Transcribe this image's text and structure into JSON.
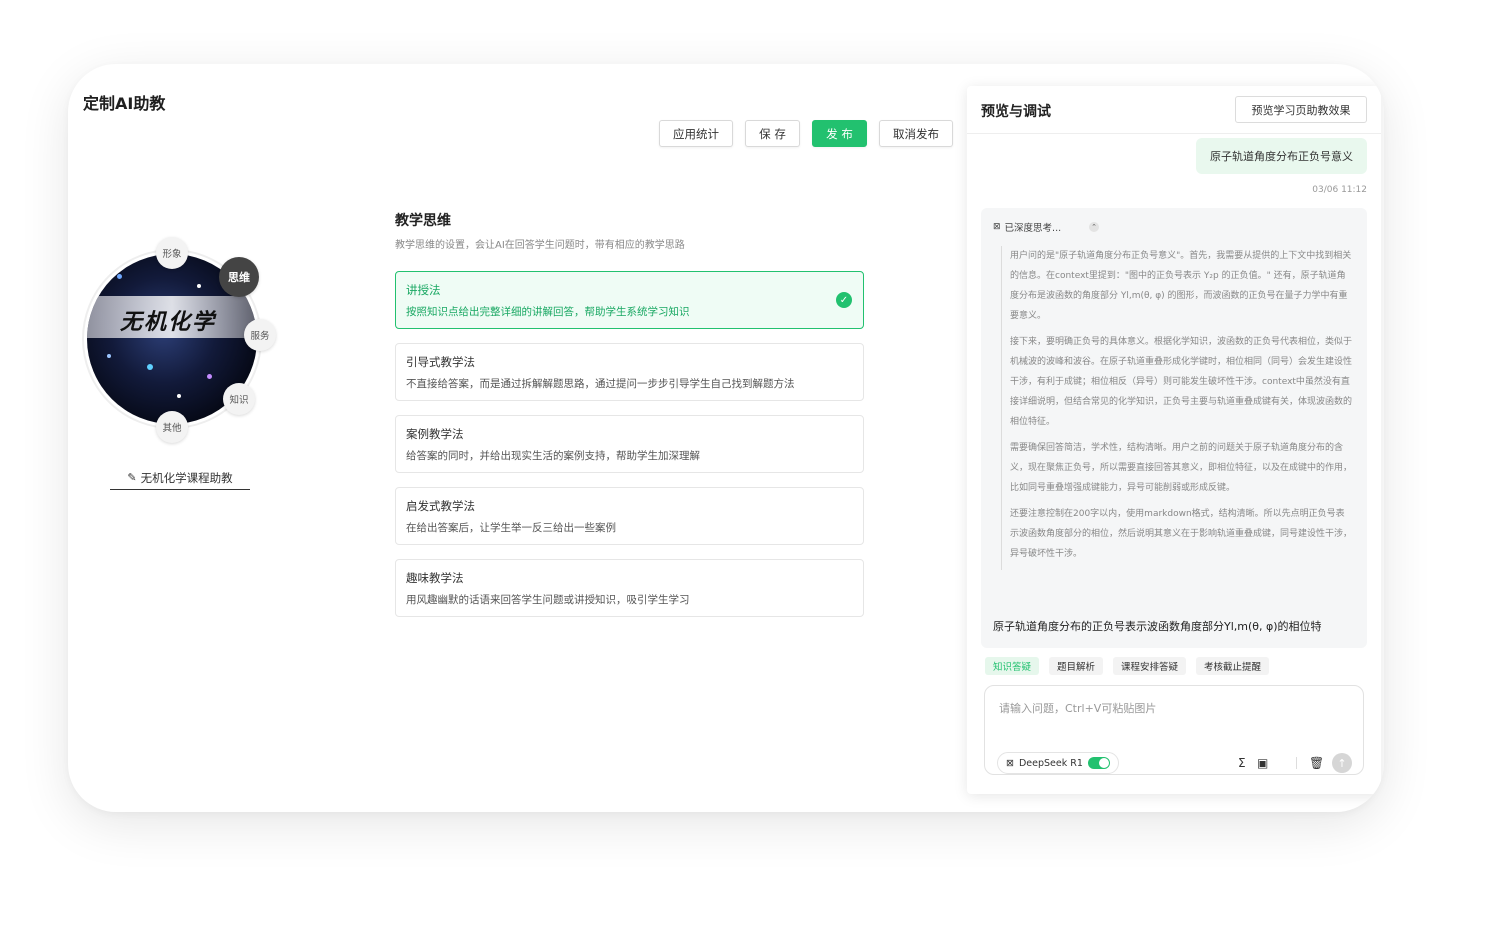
{
  "app": {
    "title": "定制AI助教"
  },
  "toolbar": {
    "stats": "应用统计",
    "save": "保 存",
    "publish": "发 布",
    "unpublish": "取消发布"
  },
  "avatar": {
    "brand_text": "无机化学",
    "chips": {
      "image": "形象",
      "thinking": "思维",
      "service": "服务",
      "knowledge": "知识",
      "other": "其他"
    },
    "name": "无机化学课程助教"
  },
  "teaching": {
    "title": "教学思维",
    "desc": "教学思维的设置，会让AI在回答学生问题时，带有相应的教学思路",
    "methods": [
      {
        "name": "讲授法",
        "desc": "按照知识点给出完整详细的讲解回答，帮助学生系统学习知识"
      },
      {
        "name": "引导式教学法",
        "desc": "不直接给答案，而是通过拆解解题思路，通过提问一步步引导学生自己找到解题方法"
      },
      {
        "name": "案例教学法",
        "desc": "给答案的同时，并给出现实生活的案例支持，帮助学生加深理解"
      },
      {
        "name": "启发式教学法",
        "desc": "在给出答案后，让学生举一反三给出一些案例"
      },
      {
        "name": "趣味教学法",
        "desc": "用风趣幽默的话语来回答学生问题或讲授知识，吸引学生学习"
      }
    ]
  },
  "panel": {
    "title": "预览与调试",
    "preview_btn": "预览学习页助教效果",
    "user_msg": "原子轨道角度分布正负号意义",
    "time": "03/06 11:12",
    "thinking_label": "已深度思考...",
    "thinking": [
      "用户问的是\"原子轨道角度分布正负号意义\"。首先，我需要从提供的上下文中找到相关的信息。在context里提到：\"图中的正负号表示 Y₂p 的正负值。\" 还有，原子轨道角度分布是波函数的角度部分 Yl,m(θ, φ) 的图形，而波函数的正负号在量子力学中有重要意义。",
      "接下来，要明确正负号的具体意义。根据化学知识，波函数的正负号代表相位，类似于机械波的波峰和波谷。在原子轨道重叠形成化学键时，相位相同（同号）会发生建设性干涉，有利于成键；相位相反（异号）则可能发生破坏性干涉。context中虽然没有直接详细说明，但结合常见的化学知识，正负号主要与轨道重叠成键有关，体现波函数的相位特征。",
      "需要确保回答简洁，学术性，结构清晰。用户之前的问题关于原子轨道角度分布的含义，现在聚焦正负号，所以需要直接回答其意义，即相位特征，以及在成键中的作用，比如同号重叠增强成键能力，异号可能削弱或形成反键。",
      "还要注意控制在200字以内，使用markdown格式，结构清晰。所以先点明正负号表示波函数角度部分的相位，然后说明其意义在于影响轨道重叠成键，同号建设性干涉，异号破坏性干涉。"
    ],
    "answer": "原子轨道角度分布的正负号表示波函数角度部分Yl,m(θ, φ)的相位特",
    "tags": [
      "知识答疑",
      "题目解析",
      "课程安排答疑",
      "考核截止提醒"
    ],
    "input_placeholder": "请输入问题，Ctrl+V可粘贴图片",
    "model": "DeepSeek R1"
  },
  "colors": {
    "accent": "#22c16f"
  }
}
